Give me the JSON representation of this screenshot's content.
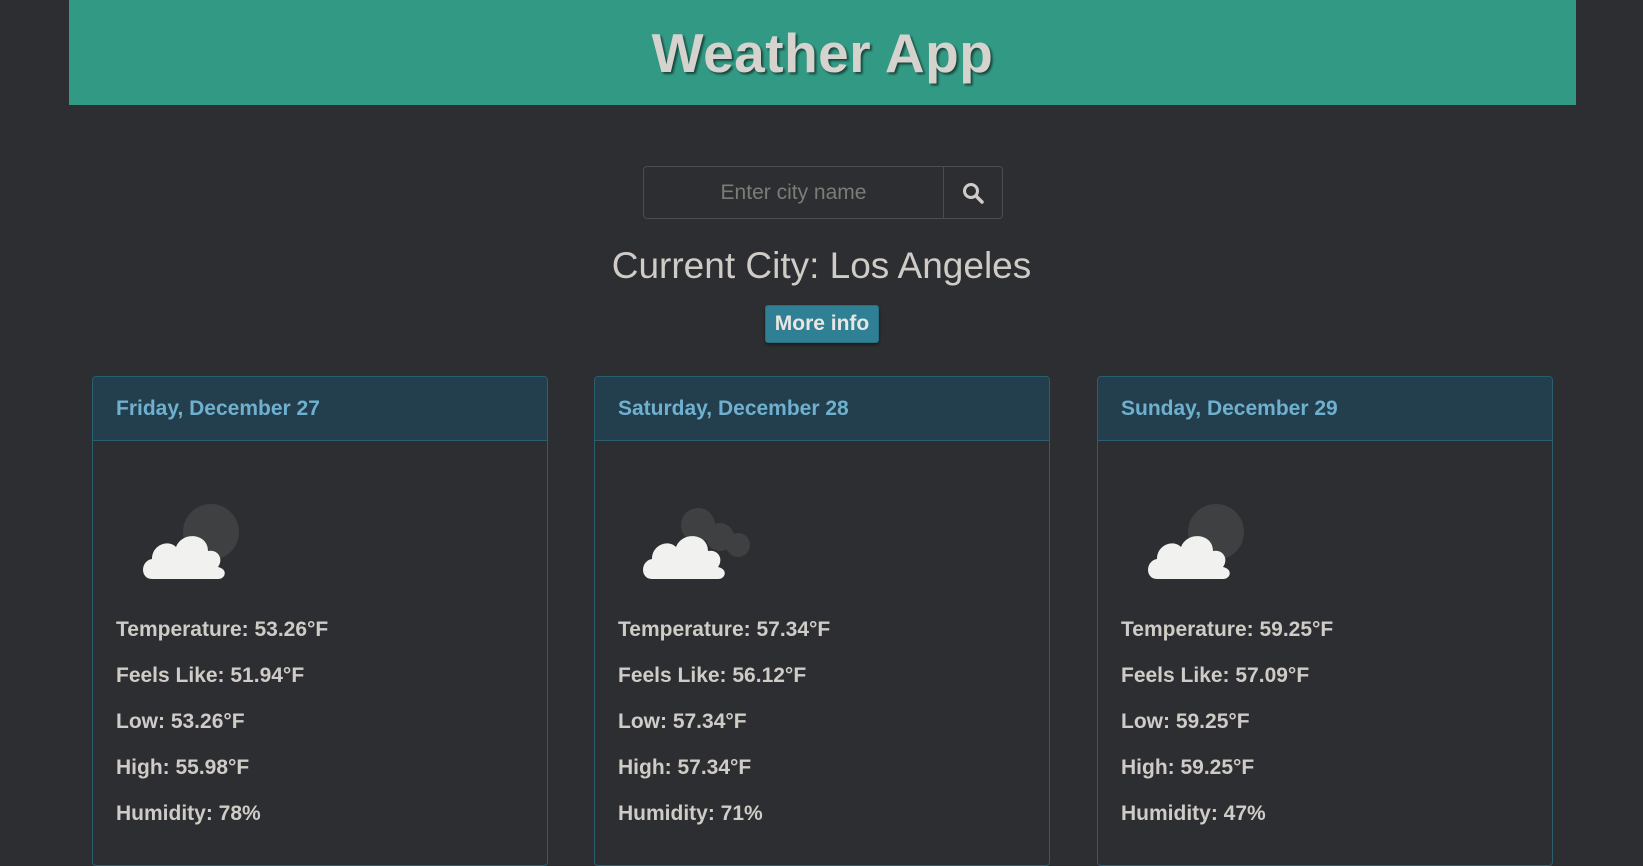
{
  "header": {
    "title": "Weather App"
  },
  "search": {
    "placeholder": "Enter city name",
    "value": ""
  },
  "current_city": {
    "label": "Current City: Los Angeles"
  },
  "more_info": {
    "label": "More info"
  },
  "colors": {
    "header_bg": "#329a84",
    "page_bg": "#2d2e31",
    "card_header_bg": "#233f4e",
    "card_header_text": "#6fb0cf",
    "button_bg": "#2f7f95"
  },
  "forecast": [
    {
      "date": "Friday, December 27",
      "icon": "partly-cloudy-night-icon",
      "temperature": "Temperature: 53.26°F",
      "feels_like": "Feels Like: 51.94°F",
      "low": "Low: 53.26°F",
      "high": "High: 55.98°F",
      "humidity": "Humidity: 78%"
    },
    {
      "date": "Saturday, December 28",
      "icon": "broken-clouds-icon",
      "temperature": "Temperature: 57.34°F",
      "feels_like": "Feels Like: 56.12°F",
      "low": "Low: 57.34°F",
      "high": "High: 57.34°F",
      "humidity": "Humidity: 71%"
    },
    {
      "date": "Sunday, December 29",
      "icon": "partly-cloudy-night-icon",
      "temperature": "Temperature: 59.25°F",
      "feels_like": "Feels Like: 57.09°F",
      "low": "Low: 59.25°F",
      "high": "High: 59.25°F",
      "humidity": "Humidity: 47%"
    }
  ]
}
